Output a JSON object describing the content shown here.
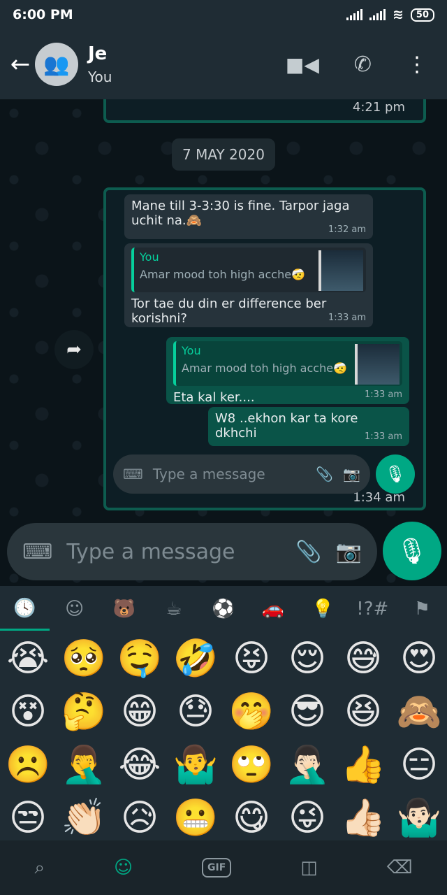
{
  "status_bar": {
    "time": "6:00 PM",
    "battery": "50"
  },
  "header": {
    "title": "Je",
    "subtitle": "You"
  },
  "chat": {
    "top_time": "4:21 pm",
    "date": "7 MAY 2020",
    "messages": [
      {
        "text": "Mane till 3-3:30 is fine. Tarpor jaga uchit na.🙈",
        "time": "1:32 am"
      },
      {
        "quote_name": "You",
        "quote_text": "Amar mood toh high acche🤕",
        "text": "Tor tae du din er difference ber korishni?",
        "time": "1:33 am"
      },
      {
        "quote_name": "You",
        "quote_text": "Amar mood toh high acche🤕",
        "text": "Eta kal ker....",
        "time": "1:33 am"
      },
      {
        "text": "W8 ..ekhon kar ta kore dkhchi",
        "time": "1:33 am"
      }
    ],
    "inner_placeholder": "Type a message",
    "inner_time": "1:34 am"
  },
  "input": {
    "placeholder": "Type a message"
  },
  "emoji_tabs": [
    "🕓",
    "☺",
    "🐻",
    "☕",
    "⚽",
    "🚗",
    "💡",
    "!?#",
    "⚑"
  ],
  "emojis": [
    "😭",
    "🥺",
    "🤤",
    "🤣",
    "😝",
    "😌",
    "😅",
    "😍",
    "😵",
    "🤔",
    "😁",
    "😓",
    "🤭",
    "😎",
    "😆",
    "🙈",
    "☹️",
    "🤦‍♂️",
    "😂",
    "🤷‍♂️",
    "🙄",
    "🤦🏻‍♂️",
    "👍",
    "😑",
    "😒",
    "👏🏻",
    "😥",
    "😬",
    "😋",
    "😜",
    "👍🏻",
    "🤷🏻‍♂️"
  ],
  "bottom_bar": {
    "gif": "GIF"
  }
}
